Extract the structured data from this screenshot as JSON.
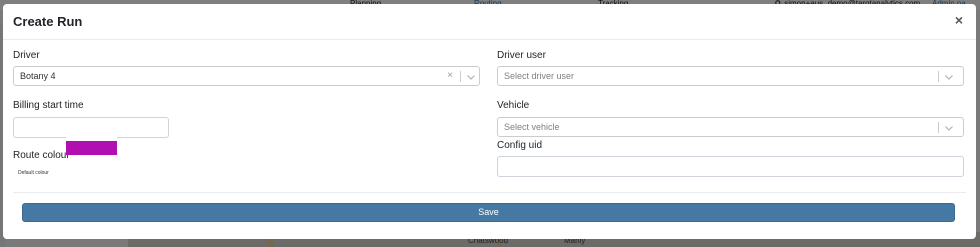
{
  "background": {
    "nav": {
      "planning": "Planning",
      "routing": "Routing",
      "tracking": "Tracking",
      "user_email": "simon+aus_demo@tarotanalytics.com",
      "admin": "Admin pa"
    },
    "map": {
      "place1": "Chatswood",
      "place2": "Manly"
    }
  },
  "modal": {
    "title": "Create Run",
    "close_symbol": "×",
    "driver": {
      "label": "Driver",
      "value": "Botany 4",
      "clear_symbol": "×"
    },
    "driver_user": {
      "label": "Driver user",
      "placeholder": "Select driver user"
    },
    "billing_start_time": {
      "label": "Billing start time",
      "value": ""
    },
    "vehicle": {
      "label": "Vehicle",
      "placeholder": "Select vehicle"
    },
    "route_colour": {
      "label": "Route colour",
      "color": "#b10fb1",
      "note": "Default colour"
    },
    "config_uid": {
      "label": "Config uid",
      "value": ""
    },
    "save_label": "Save"
  },
  "colors": {
    "primary_button": "#4578a2",
    "link": "#2a6fb0"
  },
  "icons": [
    "close-icon",
    "clear-icon",
    "chevron-down-icon",
    "search-icon"
  ]
}
